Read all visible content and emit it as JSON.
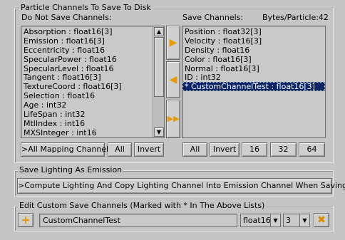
{
  "particle_group": {
    "title": "Particle Channels To Save To Disk",
    "left_header": "Do Not Save Channels:",
    "right_header": "Save Channels:",
    "bytes_label": "Bytes/Particle:42",
    "do_not_save_items": [
      "Absorption  :  float16[3]",
      "Emission  :  float16[3]",
      "Eccentricity  :  float16",
      "SpecularPower  :  float16",
      "SpecularLevel  :  float16",
      "Tangent  :  float16[3]",
      "TextureCoord  :  float16[3]",
      "Selection  :  float16",
      "Age  :  int32",
      "LifeSpan  :  int32",
      "MtlIndex  :  int16",
      "MXSInteger  :  int16"
    ],
    "save_items": [
      "Position  :  float32[3]",
      "Velocity  :  float16[3]",
      "Density  :  float16",
      "Color  :  float16[3]",
      "Normal  :  float16[3]",
      "ID  :  int32",
      "* CustomChannelTest  :  float16[3]"
    ],
    "selected_save_index": 6,
    "move_right_icon": "arrow-right-icon",
    "move_left_icon": "arrow-left-icon",
    "move_all_right_icon": "double-arrow-right-icon",
    "left_buttons": [
      ">All Mapping Channels",
      "All",
      "Invert"
    ],
    "right_buttons": [
      "All",
      "Invert",
      "16",
      "32",
      "64"
    ]
  },
  "lighting_group": {
    "title": "Save Lighting As Emission",
    "compute_button": ">Compute Lighting And Copy Lighting Channel Into Emission Channel When Saving"
  },
  "custom_group": {
    "title": "Edit Custom Save Channels (Marked with * In The Above Lists)",
    "add_icon": "plus-icon",
    "name_value": "CustomChannelTest",
    "type_value": "float16",
    "arity_value": "3",
    "delete_icon": "close-x-icon"
  },
  "colors": {
    "background": "#c5c5c5",
    "selection": "#0a246a",
    "arrow_accent": "#e89a00"
  }
}
